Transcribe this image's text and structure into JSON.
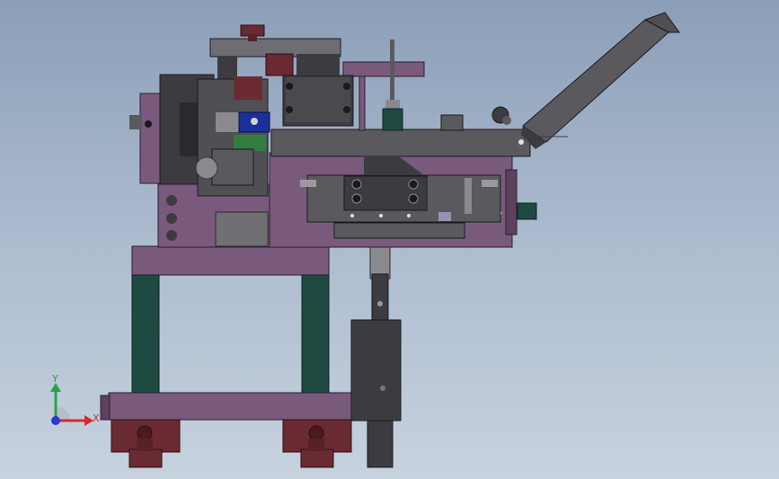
{
  "view": {
    "background_top": "#8c9fb8",
    "background_bottom": "#c7d2df"
  },
  "colors": {
    "purple": "#7a5a7c",
    "purple_dark": "#5d425f",
    "teal": "#1e4a42",
    "gray": "#5a5a5e",
    "gray_light": "#8a8a8e",
    "gray_dark": "#3c3c40",
    "maroon": "#6a2a32",
    "blue_part": "#1a2f9a",
    "green_part": "#2b8a3a",
    "lavender_block": "#9a90b5"
  },
  "triad": {
    "y_label": "Y",
    "x_label": "X",
    "y_color": "#2aa24a",
    "x_color": "#d42a2a",
    "origin_color": "#2a3ad4"
  },
  "icons": {
    "triad": "coordinate-triad-icon"
  }
}
